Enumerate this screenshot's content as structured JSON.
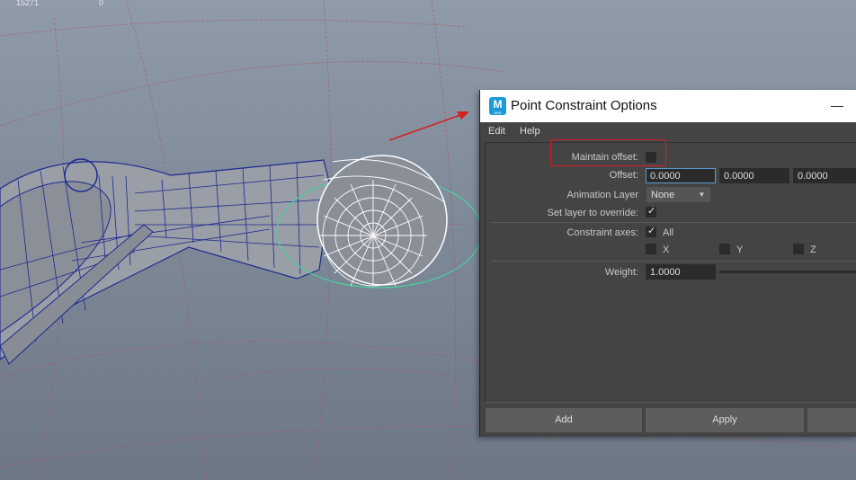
{
  "hud": {
    "left_value": "15271",
    "right_value": "0"
  },
  "dialog": {
    "title": "Point Constraint Options",
    "app_icon_letter": "M",
    "app_icon_sub": "ARR",
    "minimize_icon": "minimize-icon"
  },
  "menu": {
    "edit": "Edit",
    "help": "Help"
  },
  "form": {
    "maintain_offset_label": "Maintain offset:",
    "maintain_offset_checked": false,
    "offset_label": "Offset:",
    "offset_x": "0.0000",
    "offset_y": "0.0000",
    "offset_z": "0.0000",
    "animation_layer_label": "Animation Layer",
    "animation_layer_value": "None",
    "set_layer_label": "Set layer to override:",
    "set_layer_checked": true,
    "constraint_axes_label": "Constraint axes:",
    "axis_all_label": "All",
    "axis_all_checked": true,
    "axis_x_label": "X",
    "axis_y_label": "Y",
    "axis_z_label": "Z",
    "weight_label": "Weight:",
    "weight_value": "1.0000"
  },
  "buttons": {
    "add": "Add",
    "apply": "Apply"
  },
  "colors": {
    "annotation_red": "#d62020",
    "accent_blue": "#5c9ad6",
    "wireframe_blue": "#1d2a8f"
  }
}
